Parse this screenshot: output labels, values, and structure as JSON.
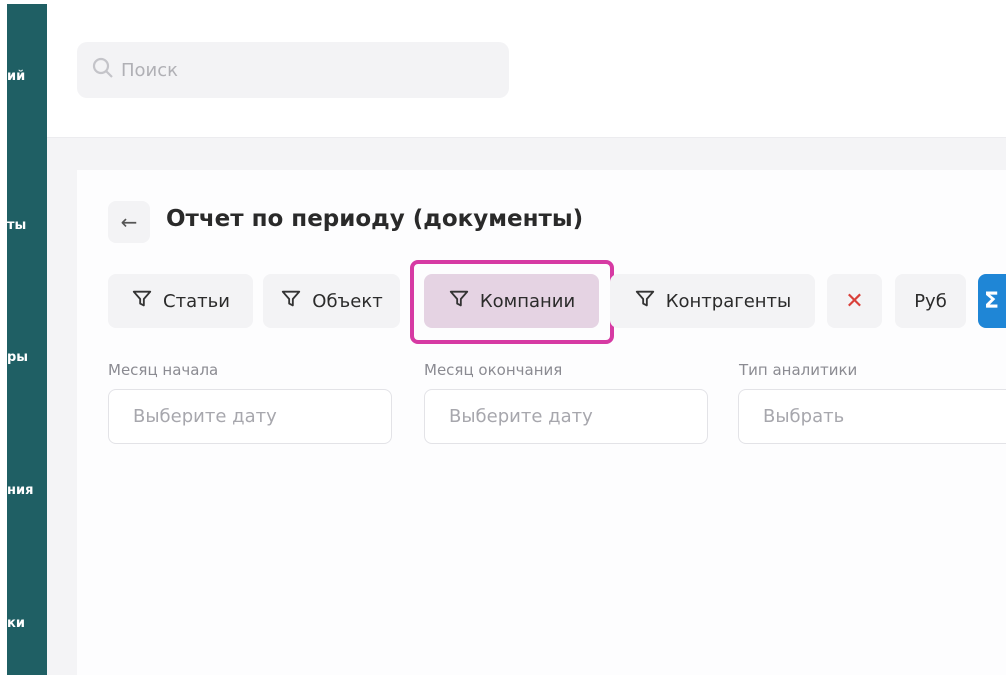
{
  "sidebar": {
    "items": [
      {
        "label": "ий"
      },
      {
        "label": "ты"
      },
      {
        "label": "ры"
      },
      {
        "label": "ния"
      },
      {
        "label": "ки"
      }
    ]
  },
  "header": {
    "search": {
      "placeholder": "Поиск",
      "icon": "search-icon"
    }
  },
  "page": {
    "back_icon": "←",
    "title": "Отчет по периоду (документы)"
  },
  "filters": [
    {
      "label": "Статьи",
      "icon": "filter-icon",
      "active": false
    },
    {
      "label": "Объект",
      "icon": "filter-icon",
      "active": false
    },
    {
      "label": "Компании",
      "icon": "filter-icon",
      "active": true
    },
    {
      "label": "Контрагенты",
      "icon": "filter-icon",
      "active": false
    }
  ],
  "toolbar": {
    "clear_label": "✕",
    "currency_label": "Руб",
    "sum_label": "Σ"
  },
  "fields": [
    {
      "label": "Месяц начала",
      "placeholder": "Выберите дату"
    },
    {
      "label": "Месяц окончания",
      "placeholder": "Выберите дату"
    },
    {
      "label": "Тип аналитики",
      "placeholder": "Выбрать"
    }
  ],
  "colors": {
    "sidebar": "#1f5f64",
    "highlight": "#d63aa3",
    "active_chip": "#e5d3e3",
    "accent_blue": "#1f86d6",
    "clear_red": "#d9403a"
  }
}
